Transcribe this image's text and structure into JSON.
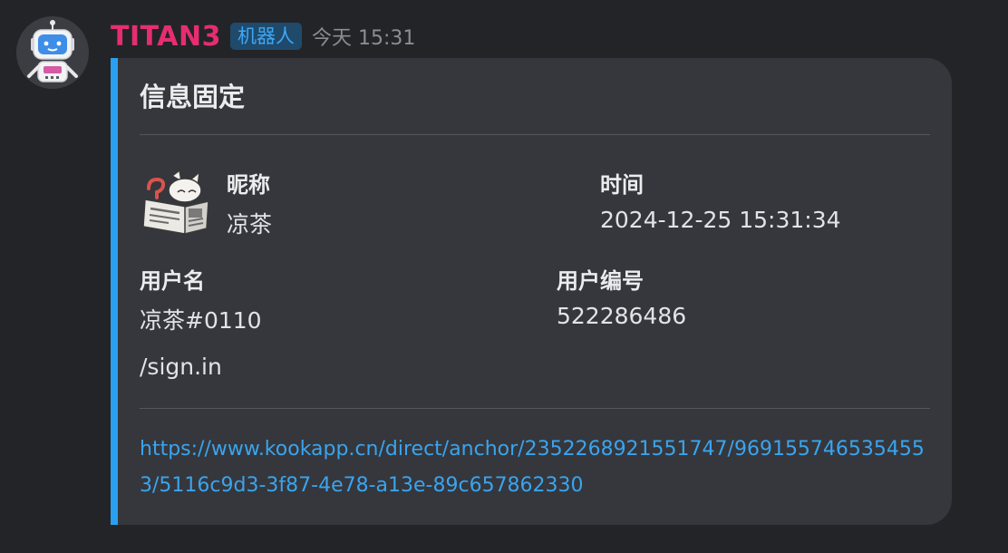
{
  "message": {
    "author": {
      "name": "TITAN3",
      "badge": "机器人",
      "avatar_icon": "robot-avatar-icon"
    },
    "timestamp": "今天 15:31"
  },
  "card": {
    "accent_color": "#2a9ff0",
    "title": "信息固定",
    "sticker_icon": "cat-reading-newspaper-sticker",
    "fields": {
      "nickname": {
        "label": "昵称",
        "value": "凉茶"
      },
      "time": {
        "label": "时间",
        "value": "2024-12-25 15:31:34"
      },
      "username": {
        "label": "用户名",
        "value": "凉茶#0110"
      },
      "user_id": {
        "label": "用户编号",
        "value": "522286486"
      }
    },
    "command": "/sign.in",
    "link": "https://www.kookapp.cn/direct/anchor/2352268921551747/9691557465354553/5116c9d3-3f87-4e78-a13e-89c657862330"
  }
}
